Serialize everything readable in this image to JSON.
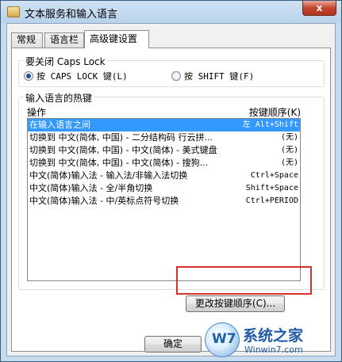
{
  "window": {
    "title": "文本服务和输入语言",
    "close_label": "x"
  },
  "tabs": [
    {
      "label": "常规",
      "active": false
    },
    {
      "label": "语言栏",
      "active": false
    },
    {
      "label": "高级键设置",
      "active": true
    }
  ],
  "caps_lock": {
    "legend": "要关闭 Caps Lock",
    "options": [
      {
        "label": "按 CAPS LOCK 键(L)",
        "checked": true
      },
      {
        "label": "按 SHIFT 键(F)",
        "checked": false
      }
    ]
  },
  "hotkeys": {
    "legend": "输入语言的热键",
    "col_action": "操作",
    "col_key": "按键顺序(K)",
    "rows": [
      {
        "action": "在输入语言之间",
        "key": "左 Alt+Shift",
        "selected": true
      },
      {
        "action": "切换到 中文(简体, 中国) - 二分结构码 行云拼...",
        "key": "(无)",
        "selected": false
      },
      {
        "action": "切换到 中文(简体, 中国) - 中文(简体) - 美式键盘",
        "key": "(无)",
        "selected": false
      },
      {
        "action": "切换到 中文(简体, 中国) - 中文(简体) - 搜狗...",
        "key": "(无)",
        "selected": false
      },
      {
        "action": "中文(简体)输入法 - 输入法/非输入法切换",
        "key": "Ctrl+Space",
        "selected": false
      },
      {
        "action": "中文(简体)输入法 - 全/半角切换",
        "key": "Shift+Space",
        "selected": false
      },
      {
        "action": "中文(简体)输入法 - 中/英标点符号切换",
        "key": "Ctrl+PERIOD",
        "selected": false
      }
    ],
    "change_button": "更改按键顺序(C)..."
  },
  "footer": {
    "ok_label": "确定"
  },
  "watermark": {
    "logo_text": "W7",
    "text": "系统之家",
    "url": "Winwin7.com"
  }
}
